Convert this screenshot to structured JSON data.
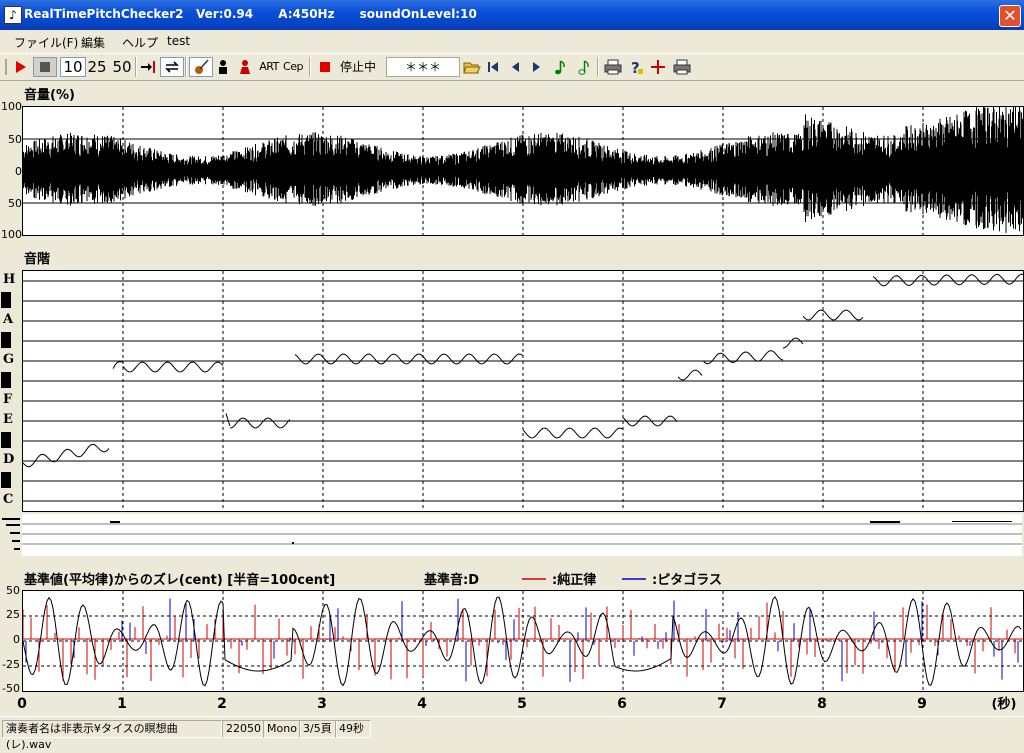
{
  "window": {
    "icon_glyph": "♪",
    "title": "RealTimePitchChecker2   Ver:0.94      A:450Hz      soundOnLevel:10",
    "close_glyph": "✕"
  },
  "menu": {
    "file": "ファイル(F)",
    "edit": "編集",
    "help": "ヘルプ",
    "test": "test"
  },
  "toolbar": {
    "play_icon": "play-icon",
    "stop_icon": "stop-icon",
    "zoom_10": "10",
    "zoom_25": "25",
    "zoom_50": "50",
    "art": "ART",
    "cep": "Cep",
    "status_text": "停止中",
    "note_display": "＊＊＊"
  },
  "volume": {
    "label": "音量(%)",
    "ticks": [
      "100",
      "50",
      "0",
      "50",
      "100"
    ]
  },
  "scale": {
    "label": "音階",
    "notes": [
      "H",
      "A",
      "G",
      "F",
      "E",
      "D",
      "C"
    ]
  },
  "deviation": {
    "label": "基準値(平均律)からのズレ(cent) [半音=100cent]",
    "base_note": "基準音:D",
    "legend_just": ":純正律",
    "legend_pyth": ":ピタゴラス",
    "legend_just_color": "#cc0000",
    "legend_pyth_color": "#0000cc",
    "ticks": [
      "50",
      "25",
      "0",
      "-25",
      "-50"
    ]
  },
  "time_axis": {
    "labels": [
      "0",
      "1",
      "2",
      "3",
      "4",
      "5",
      "6",
      "7",
      "8",
      "9"
    ],
    "unit": "(秒)"
  },
  "statusbar": {
    "file": "演奏者名は非表示¥タイスの瞑想曲(レ).wav",
    "rate": "22050",
    "channels": "Mono",
    "page": "3/5頁",
    "length": "49秒"
  }
}
